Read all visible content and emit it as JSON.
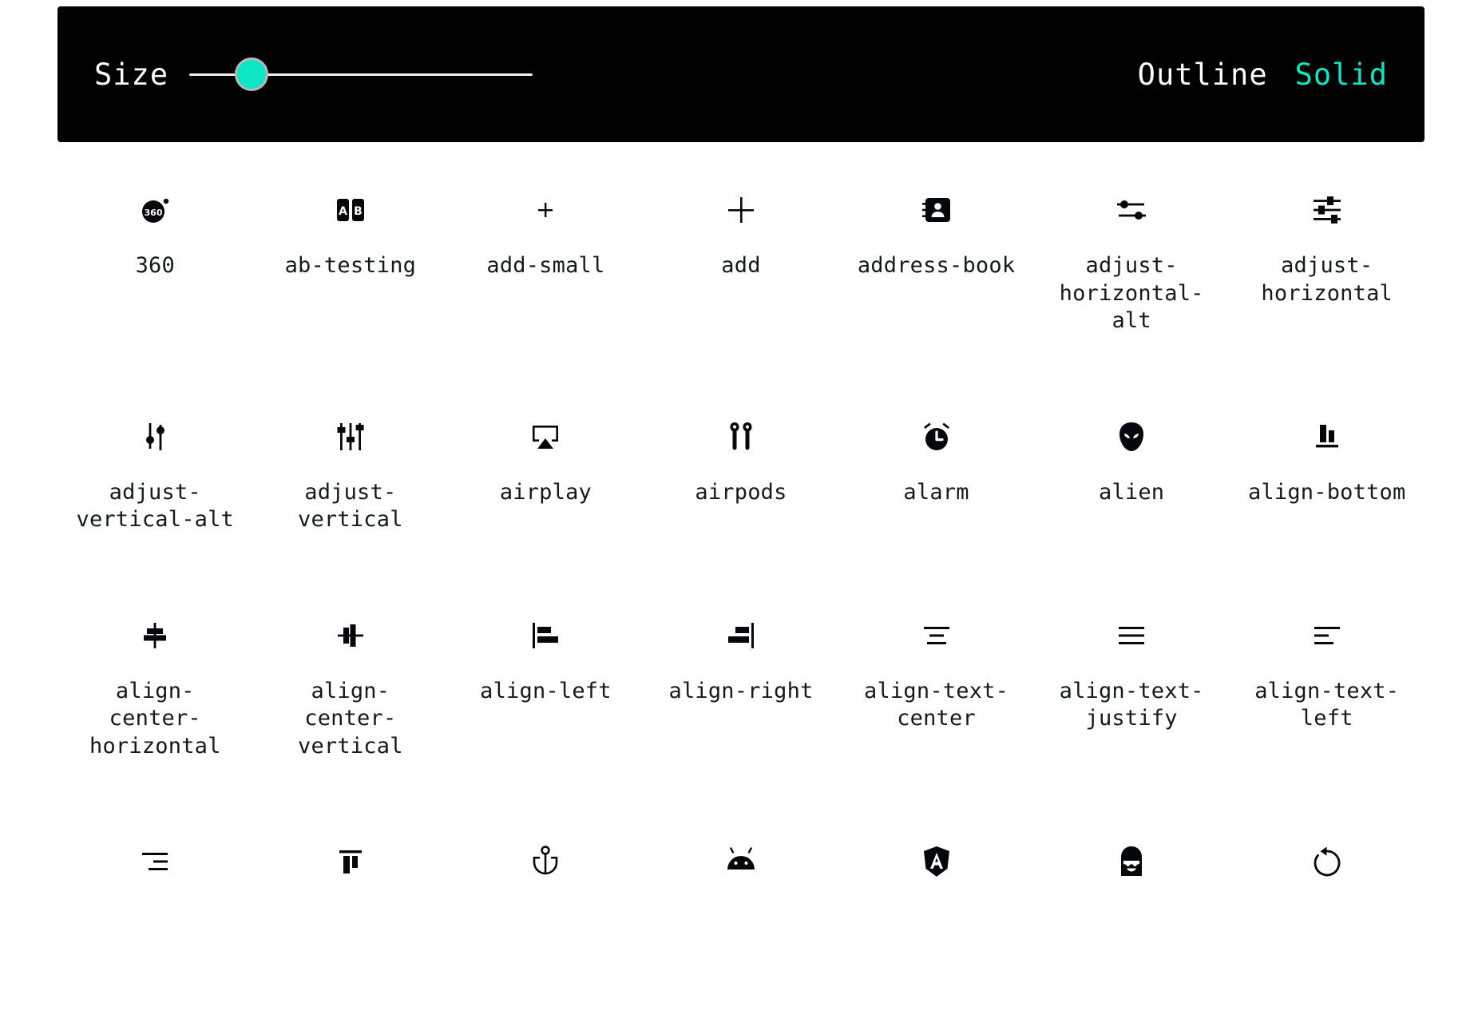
{
  "toolbar": {
    "size_label": "Size",
    "slider": {
      "name": "size-slider",
      "value": 18,
      "min": 0,
      "max": 100,
      "thumb_color": "#0ce6c4",
      "track_color": "#f2f2f2"
    },
    "modes": [
      {
        "label": "Outline",
        "active": false
      },
      {
        "label": "Solid",
        "active": true
      }
    ],
    "background": "#000000",
    "accent": "#0ce6c4"
  },
  "grid": {
    "columns": 7,
    "icons": [
      {
        "name": "360",
        "label": "360"
      },
      {
        "name": "ab-testing",
        "label": "ab-testing"
      },
      {
        "name": "add-small",
        "label": "add-small"
      },
      {
        "name": "add",
        "label": "add"
      },
      {
        "name": "address-book",
        "label": "address-book"
      },
      {
        "name": "adjust-horizontal-alt",
        "label": "adjust-horizontal-alt"
      },
      {
        "name": "adjust-horizontal",
        "label": "adjust-horizontal"
      },
      {
        "name": "adjust-vertical-alt",
        "label": "adjust-vertical-alt"
      },
      {
        "name": "adjust-vertical",
        "label": "adjust-vertical"
      },
      {
        "name": "airplay",
        "label": "airplay"
      },
      {
        "name": "airpods",
        "label": "airpods"
      },
      {
        "name": "alarm",
        "label": "alarm"
      },
      {
        "name": "alien",
        "label": "alien"
      },
      {
        "name": "align-bottom",
        "label": "align-bottom"
      },
      {
        "name": "align-center-horizontal",
        "label": "align-center-horizontal"
      },
      {
        "name": "align-center-vertical",
        "label": "align-center-vertical"
      },
      {
        "name": "align-left",
        "label": "align-left"
      },
      {
        "name": "align-right",
        "label": "align-right"
      },
      {
        "name": "align-text-center",
        "label": "align-text-center"
      },
      {
        "name": "align-text-justify",
        "label": "align-text-justify"
      },
      {
        "name": "align-text-left",
        "label": "align-text-left"
      },
      {
        "name": "align-text-right",
        "label": ""
      },
      {
        "name": "align-top",
        "label": ""
      },
      {
        "name": "anchor",
        "label": ""
      },
      {
        "name": "android",
        "label": ""
      },
      {
        "name": "angular",
        "label": ""
      },
      {
        "name": "anonymous",
        "label": ""
      },
      {
        "name": "rotate-left",
        "label": ""
      }
    ]
  }
}
